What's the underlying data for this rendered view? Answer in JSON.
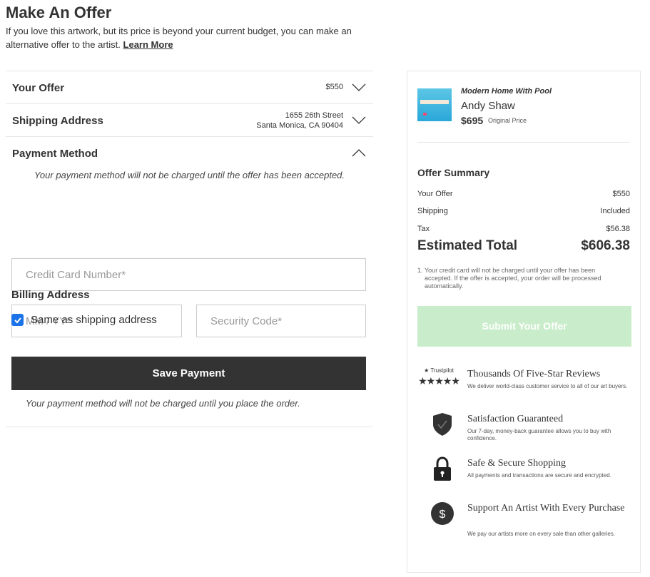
{
  "header": {
    "title": "Make An Offer",
    "intro": "If you love this artwork, but its price is beyond your current budget, you can make an alternative offer to the artist.",
    "learn_more": "Learn More"
  },
  "accordion": {
    "offer": {
      "label": "Your Offer",
      "value": "$550"
    },
    "shipping": {
      "label": "Shipping Address",
      "line1": "1655 26th Street",
      "line2": "Santa Monica, CA 90404"
    },
    "payment": {
      "label": "Payment Method",
      "note": "Your payment method will not be charged until the offer has been accepted.",
      "card_placeholder": "Credit Card Number*",
      "expiry_placeholder": "MM / YY*",
      "cvc_placeholder": "Security Code*",
      "billing_title": "Billing Address",
      "same_as_shipping": "Same as shipping address",
      "same_as_shipping_checked": true,
      "save_label": "Save Payment",
      "bottom_note": "Your payment method will not be charged until you place the order."
    }
  },
  "artwork": {
    "title": "Modern Home With Pool",
    "artist": "Andy Shaw",
    "price": "$695",
    "price_label": "Original Price"
  },
  "summary": {
    "title": "Offer Summary",
    "rows": [
      {
        "label": "Your Offer",
        "value": "$550"
      },
      {
        "label": "Shipping",
        "value": "Included"
      },
      {
        "label": "Tax",
        "value": "$56.38"
      }
    ],
    "total_label": "Estimated Total",
    "total_value": "$606.38",
    "footnote_num": "1.",
    "footnote": "Your credit card will not be charged until your offer has been accepted. If the offer is accepted, your order will be processed automatically.",
    "submit_label": "Submit Your Offer"
  },
  "trust": [
    {
      "icon": "trustpilot-icon",
      "brand": "★ Trustpilot",
      "stars": "★★★★★",
      "title": "Thousands Of Five-Star Reviews",
      "desc": "We deliver world-class customer service to all of our art buyers."
    },
    {
      "icon": "shield-check-icon",
      "title": "Satisfaction Guaranteed",
      "desc": "Our 7-day, money-back guarantee allows you to buy with confidence."
    },
    {
      "icon": "lock-icon",
      "title": "Safe & Secure Shopping",
      "desc": "All payments and transactions are secure and encrypted."
    },
    {
      "icon": "dollar-icon",
      "title": "Support An Artist With Every Purchase",
      "desc": "We pay our artists more on every sale than other galleries."
    }
  ],
  "colors": {
    "text": "#333333",
    "button_dark": "#333333",
    "submit_disabled": "#c9edca",
    "checkbox": "#1a73e8",
    "border": "#e6e6e6"
  }
}
